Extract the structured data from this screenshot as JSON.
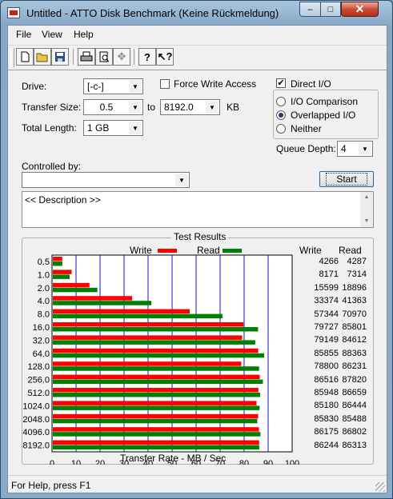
{
  "window": {
    "title": "Untitled - ATTO Disk Benchmark (Keine Rückmeldung)"
  },
  "menu": [
    "File",
    "View",
    "Help"
  ],
  "toolbar": {
    "icons": [
      "new-file-icon",
      "open-folder-icon",
      "save-icon",
      "print-icon",
      "print-preview-icon",
      "move-icon",
      "help-icon",
      "context-help-icon"
    ]
  },
  "form": {
    "drive_label": "Drive:",
    "drive_value": "[-c-]",
    "force_write_label": "Force Write Access",
    "force_write_checked": false,
    "transfer_size_label": "Transfer Size:",
    "transfer_from": "0.5",
    "to_label": "to",
    "transfer_to": "8192.0",
    "kb_label": "KB",
    "total_length_label": "Total Length:",
    "total_length_value": "1 GB",
    "direct_io_label": "Direct I/O",
    "direct_io_checked": true,
    "io_comparison_label": "I/O Comparison",
    "overlapped_io_label": "Overlapped I/O",
    "neither_label": "Neither",
    "selected_io_mode": "Overlapped I/O",
    "queue_depth_label": "Queue Depth:",
    "queue_depth_value": "4",
    "controlled_by_label": "Controlled by:",
    "controlled_by_value": "",
    "start_label": "Start",
    "description": "<< Description >>"
  },
  "results": {
    "title": "Test Results",
    "legend_write": "Write",
    "legend_read": "Read",
    "col_write": "Write",
    "col_read": "Read",
    "write_color": "#ff0000",
    "read_color": "#008000",
    "rows": [
      {
        "size": "0.5",
        "write": "4266",
        "read": "4287"
      },
      {
        "size": "1.0",
        "write": "8171",
        "read": "7314"
      },
      {
        "size": "2.0",
        "write": "15599",
        "read": "18896"
      },
      {
        "size": "4.0",
        "write": "33374",
        "read": "41363"
      },
      {
        "size": "8.0",
        "write": "57344",
        "read": "70970"
      },
      {
        "size": "16.0",
        "write": "79727",
        "read": "85801"
      },
      {
        "size": "32.0",
        "write": "79149",
        "read": "84612"
      },
      {
        "size": "64.0",
        "write": "85855",
        "read": "88363"
      },
      {
        "size": "128.0",
        "write": "78800",
        "read": "86231"
      },
      {
        "size": "256.0",
        "write": "86516",
        "read": "87820"
      },
      {
        "size": "512.0",
        "write": "85948",
        "read": "86659"
      },
      {
        "size": "1024.0",
        "write": "85180",
        "read": "86444"
      },
      {
        "size": "2048.0",
        "write": "85830",
        "read": "85488"
      },
      {
        "size": "4096.0",
        "write": "86175",
        "read": "86802"
      },
      {
        "size": "8192.0",
        "write": "86244",
        "read": "86313"
      }
    ],
    "x_ticks": [
      "0",
      "10",
      "20",
      "30",
      "40",
      "50",
      "60",
      "70",
      "80",
      "90",
      "100"
    ],
    "x_axis_label": "Transfer Rate - MB / Sec"
  },
  "chart_data": {
    "type": "bar",
    "title": "Test Results",
    "xlabel": "Transfer Rate - MB / Sec",
    "xlim": [
      0,
      100
    ],
    "categories": [
      "0.5",
      "1.0",
      "2.0",
      "4.0",
      "8.0",
      "16.0",
      "32.0",
      "64.0",
      "128.0",
      "256.0",
      "512.0",
      "1024.0",
      "2048.0",
      "4096.0",
      "8192.0"
    ],
    "series": [
      {
        "name": "Write",
        "values": [
          4.266,
          8.171,
          15.599,
          33.374,
          57.344,
          79.727,
          79.149,
          85.855,
          78.8,
          86.516,
          85.948,
          85.18,
          85.83,
          86.175,
          86.244
        ]
      },
      {
        "name": "Read",
        "values": [
          4.287,
          7.314,
          18.896,
          41.363,
          70.97,
          85.801,
          84.612,
          88.363,
          86.231,
          87.82,
          86.659,
          86.444,
          85.488,
          86.802,
          86.313
        ]
      }
    ]
  },
  "status": {
    "text": "For Help, press F1"
  }
}
